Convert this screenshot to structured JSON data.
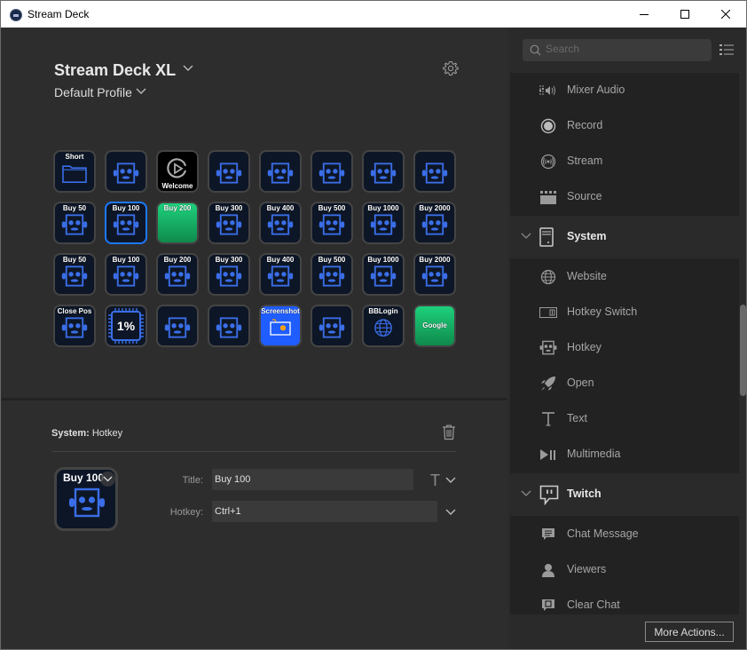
{
  "window": {
    "title": "Stream Deck",
    "controls": [
      "minimize-icon",
      "maximize-icon",
      "close-icon"
    ]
  },
  "device": {
    "name": "Stream Deck XL",
    "profile": "Default Profile",
    "settings_icon": "gear-icon"
  },
  "keys": [
    {
      "label": "Short",
      "style": "dark",
      "icon": "folder-icon",
      "pos": "top"
    },
    {
      "label": "",
      "style": "dark",
      "icon": "hotkey-robot-icon"
    },
    {
      "label": "Welcome",
      "style": "black",
      "icon": "elgato-logo-icon",
      "pos": "bottom"
    },
    {
      "label": "",
      "style": "dark",
      "icon": "hotkey-robot-icon"
    },
    {
      "label": "",
      "style": "dark",
      "icon": "hotkey-robot-icon"
    },
    {
      "label": "",
      "style": "dark",
      "icon": "hotkey-robot-icon"
    },
    {
      "label": "",
      "style": "dark",
      "icon": "hotkey-robot-icon"
    },
    {
      "label": "",
      "style": "dark",
      "icon": "hotkey-robot-icon"
    },
    {
      "label": "Buy 50",
      "style": "dark",
      "icon": "hotkey-robot-icon",
      "pos": "top"
    },
    {
      "label": "Buy 100",
      "style": "dark",
      "icon": "hotkey-robot-icon",
      "pos": "top",
      "selected": true
    },
    {
      "label": "Buy 200",
      "style": "green",
      "icon": "",
      "pos": "top"
    },
    {
      "label": "Buy 300",
      "style": "dark",
      "icon": "hotkey-robot-icon",
      "pos": "top"
    },
    {
      "label": "Buy 400",
      "style": "dark",
      "icon": "hotkey-robot-icon",
      "pos": "top"
    },
    {
      "label": "Buy 500",
      "style": "dark",
      "icon": "hotkey-robot-icon",
      "pos": "top"
    },
    {
      "label": "Buy 1000",
      "style": "dark",
      "icon": "hotkey-robot-icon",
      "pos": "top"
    },
    {
      "label": "Buy 2000",
      "style": "dark",
      "icon": "hotkey-robot-icon",
      "pos": "top"
    },
    {
      "label": "Buy 50",
      "style": "dark",
      "icon": "hotkey-robot-icon",
      "pos": "top"
    },
    {
      "label": "Buy 100",
      "style": "dark",
      "icon": "hotkey-robot-icon",
      "pos": "top"
    },
    {
      "label": "Buy 200",
      "style": "dark",
      "icon": "hotkey-robot-icon",
      "pos": "top"
    },
    {
      "label": "Buy 300",
      "style": "dark",
      "icon": "hotkey-robot-icon",
      "pos": "top"
    },
    {
      "label": "Buy 400",
      "style": "dark",
      "icon": "hotkey-robot-icon",
      "pos": "top"
    },
    {
      "label": "Buy 500",
      "style": "dark",
      "icon": "hotkey-robot-icon",
      "pos": "top"
    },
    {
      "label": "Buy 1000",
      "style": "dark",
      "icon": "hotkey-robot-icon",
      "pos": "top"
    },
    {
      "label": "Buy 2000",
      "style": "dark",
      "icon": "hotkey-robot-icon",
      "pos": "top"
    },
    {
      "label": "Close Pos",
      "style": "dark",
      "icon": "hotkey-robot-icon",
      "pos": "top"
    },
    {
      "label": "1%",
      "style": "dark",
      "icon": "cpu-chip-icon",
      "pos": "pct"
    },
    {
      "label": "",
      "style": "dark",
      "icon": "hotkey-robot-icon"
    },
    {
      "label": "",
      "style": "dark",
      "icon": "hotkey-robot-icon"
    },
    {
      "label": "Screenshot",
      "style": "blue",
      "icon": "screenshot-icon",
      "pos": "top"
    },
    {
      "label": "",
      "style": "dark",
      "icon": "hotkey-robot-icon"
    },
    {
      "label": "BBLogin",
      "style": "dark",
      "icon": "globe-icon",
      "pos": "top"
    },
    {
      "label": "Google",
      "style": "green",
      "icon": "",
      "pos": "center"
    }
  ],
  "properties": {
    "category": "System:",
    "action": "Hotkey",
    "preview_label": "Buy 100",
    "title_label": "Title:",
    "title_value": "Buy 100",
    "hotkey_label": "Hotkey:",
    "hotkey_value": "Ctrl+1",
    "delete_icon": "trash-icon",
    "text_format_icon": "text-format-icon"
  },
  "actions_panel": {
    "search_placeholder": "Search",
    "items": [
      {
        "type": "item",
        "label": "Mixer Audio",
        "icon": "mixer-audio-icon"
      },
      {
        "type": "item",
        "label": "Record",
        "icon": "record-icon"
      },
      {
        "type": "item",
        "label": "Stream",
        "icon": "stream-icon"
      },
      {
        "type": "item",
        "label": "Source",
        "icon": "clapperboard-icon"
      },
      {
        "type": "category",
        "label": "System",
        "icon": "pc-tower-icon",
        "expanded": true
      },
      {
        "type": "item",
        "label": "Website",
        "icon": "globe-icon"
      },
      {
        "type": "item",
        "label": "Hotkey Switch",
        "icon": "hotkey-switch-icon"
      },
      {
        "type": "item",
        "label": "Hotkey",
        "icon": "hotkey-robot-icon"
      },
      {
        "type": "item",
        "label": "Open",
        "icon": "rocket-icon"
      },
      {
        "type": "item",
        "label": "Text",
        "icon": "text-icon"
      },
      {
        "type": "item",
        "label": "Multimedia",
        "icon": "play-pause-icon"
      },
      {
        "type": "category",
        "label": "Twitch",
        "icon": "twitch-icon",
        "expanded": true
      },
      {
        "type": "item",
        "label": "Chat Message",
        "icon": "chat-message-icon"
      },
      {
        "type": "item",
        "label": "Viewers",
        "icon": "user-icon"
      },
      {
        "type": "item",
        "label": "Clear Chat",
        "icon": "clear-chat-icon"
      }
    ],
    "more_button": "More Actions..."
  },
  "colors": {
    "accent_selected": "#1e78ff",
    "key_bg": "#0d1626",
    "icon_blue": "#3a6ee8",
    "green_key": "#1ed07c",
    "blue_key": "#1f5dff"
  }
}
